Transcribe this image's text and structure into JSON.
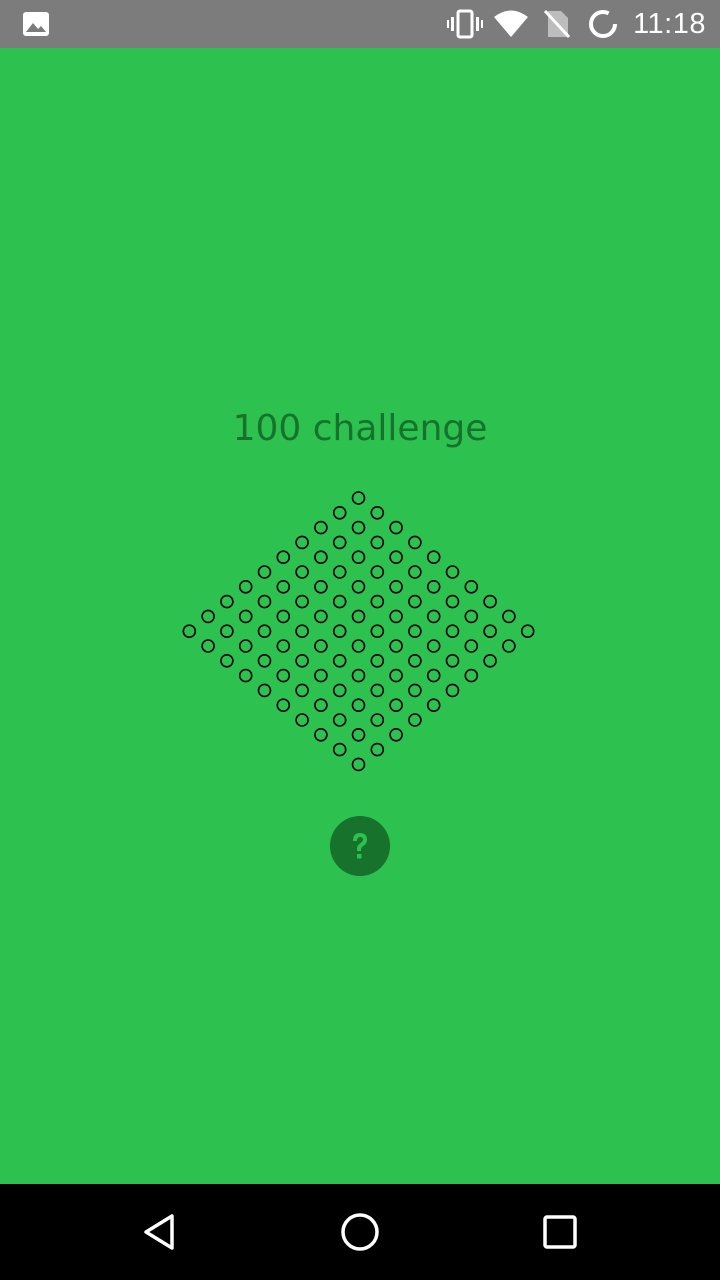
{
  "status_bar": {
    "time": "11:18",
    "icons": [
      "image-notification-icon",
      "vibrate-icon",
      "wifi-icon",
      "no-sim-icon",
      "sync-icon"
    ]
  },
  "main": {
    "title": "100 challenge",
    "board": {
      "shape": "diamond",
      "layout": "diagonal grid of small circles",
      "cell_count": 100,
      "filled_count": 0
    },
    "help_icon": "help-question-icon"
  },
  "nav_bar": {
    "icons": [
      "back-icon",
      "home-icon",
      "recents-icon"
    ]
  },
  "colors": {
    "background": "#2dc24f",
    "accent": "#17722b",
    "status_bar": "#7c7c7c",
    "nav_bar": "#000000"
  }
}
